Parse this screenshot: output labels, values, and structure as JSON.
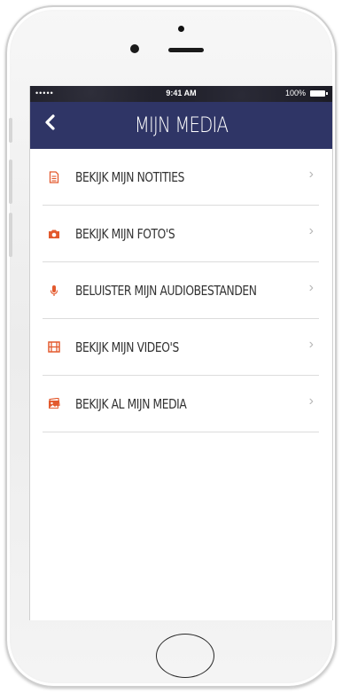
{
  "status_bar": {
    "carrier": "•••••",
    "time": "9:41 AM",
    "battery": "100%"
  },
  "header": {
    "back_icon": "chevron-left-icon",
    "title": "MIJN MEDIA"
  },
  "colors": {
    "navbar": "#2f3566",
    "accent": "#e35a2e"
  },
  "menu": [
    {
      "label": "BEKIJK MIJN NOTITIES",
      "icon": "note-icon"
    },
    {
      "label": "BEKIJK MIJN FOTO'S",
      "icon": "camera-icon"
    },
    {
      "label": "BELUISTER MIJN AUDIOBESTANDEN",
      "icon": "microphone-icon"
    },
    {
      "label": "BEKIJK MIJN VIDEO'S",
      "icon": "film-icon"
    },
    {
      "label": "BEKIJK AL MIJN MEDIA",
      "icon": "media-icon"
    }
  ]
}
